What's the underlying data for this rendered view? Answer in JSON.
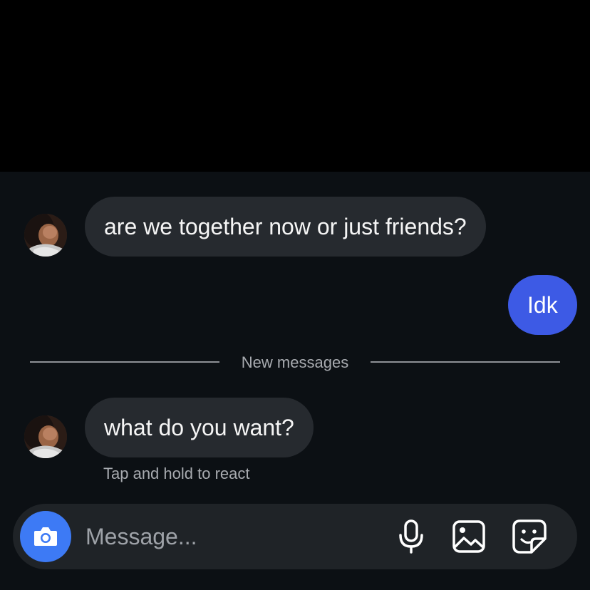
{
  "colors": {
    "background": "#0c1014",
    "incoming_bubble": "#262a2f",
    "outgoing_bubble": "#3d5ae5",
    "camera_button": "#3d7af5"
  },
  "conversation": {
    "messages": [
      {
        "direction": "incoming",
        "text": "are we together now or just friends?"
      },
      {
        "direction": "outgoing",
        "text": "Idk"
      },
      {
        "direction": "incoming",
        "text": "what do you want?"
      }
    ],
    "new_messages_divider": "New messages",
    "react_hint": "Tap and hold to react"
  },
  "composer": {
    "placeholder": "Message...",
    "icons": [
      "camera-icon",
      "microphone-icon",
      "gallery-icon",
      "sticker-icon"
    ]
  }
}
